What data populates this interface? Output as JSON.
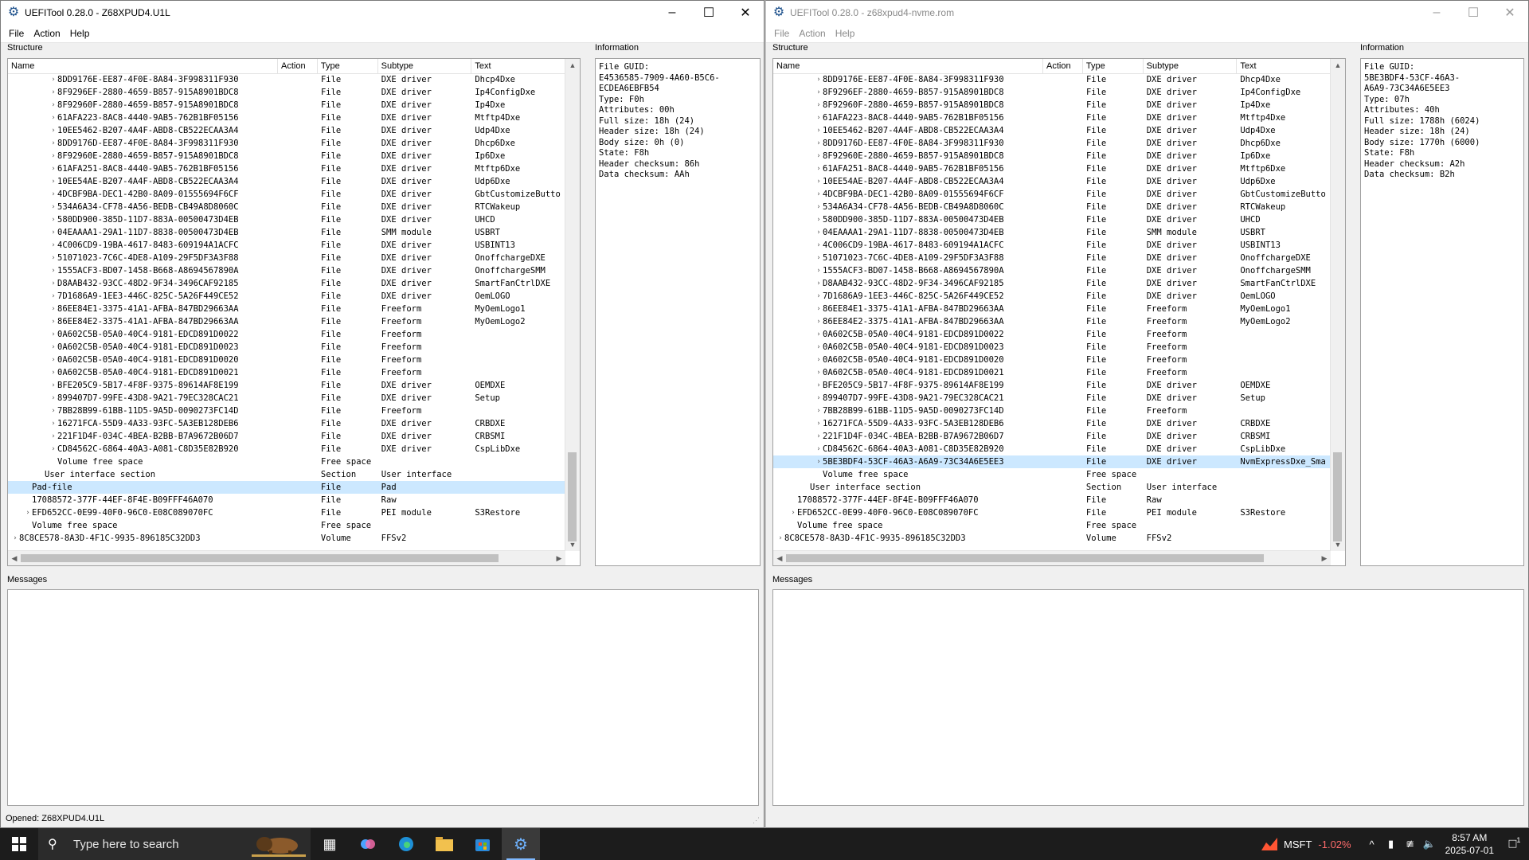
{
  "windows": [
    {
      "id": "L",
      "title": "UEFITool 0.28.0 - Z68XPUD4.U1L",
      "active": true,
      "menu": [
        "File",
        "Action",
        "Help"
      ],
      "labels": {
        "structure": "Structure",
        "information": "Information",
        "messages": "Messages"
      },
      "columns": [
        "Name",
        "Action",
        "Type",
        "Subtype",
        "Text"
      ],
      "rows": [
        {
          "indent": 3,
          "arrow": "›",
          "name": "8DD9176E-EE87-4F0E-8A84-3F998311F930",
          "action": "",
          "type": "File",
          "subtype": "DXE driver",
          "text": "Dhcp4Dxe"
        },
        {
          "indent": 3,
          "arrow": "›",
          "name": "8F9296EF-2880-4659-B857-915A8901BDC8",
          "action": "",
          "type": "File",
          "subtype": "DXE driver",
          "text": "Ip4ConfigDxe"
        },
        {
          "indent": 3,
          "arrow": "›",
          "name": "8F92960F-2880-4659-B857-915A8901BDC8",
          "action": "",
          "type": "File",
          "subtype": "DXE driver",
          "text": "Ip4Dxe"
        },
        {
          "indent": 3,
          "arrow": "›",
          "name": "61AFA223-8AC8-4440-9AB5-762B1BF05156",
          "action": "",
          "type": "File",
          "subtype": "DXE driver",
          "text": "Mtftp4Dxe"
        },
        {
          "indent": 3,
          "arrow": "›",
          "name": "10EE5462-B207-4A4F-ABD8-CB522ECAA3A4",
          "action": "",
          "type": "File",
          "subtype": "DXE driver",
          "text": "Udp4Dxe"
        },
        {
          "indent": 3,
          "arrow": "›",
          "name": "8DD9176D-EE87-4F0E-8A84-3F998311F930",
          "action": "",
          "type": "File",
          "subtype": "DXE driver",
          "text": "Dhcp6Dxe"
        },
        {
          "indent": 3,
          "arrow": "›",
          "name": "8F92960E-2880-4659-B857-915A8901BDC8",
          "action": "",
          "type": "File",
          "subtype": "DXE driver",
          "text": "Ip6Dxe"
        },
        {
          "indent": 3,
          "arrow": "›",
          "name": "61AFA251-8AC8-4440-9AB5-762B1BF05156",
          "action": "",
          "type": "File",
          "subtype": "DXE driver",
          "text": "Mtftp6Dxe"
        },
        {
          "indent": 3,
          "arrow": "›",
          "name": "10EE54AE-B207-4A4F-ABD8-CB522ECAA3A4",
          "action": "",
          "type": "File",
          "subtype": "DXE driver",
          "text": "Udp6Dxe"
        },
        {
          "indent": 3,
          "arrow": "›",
          "name": "4DCBF9BA-DEC1-42B0-8A09-01555694F6CF",
          "action": "",
          "type": "File",
          "subtype": "DXE driver",
          "text": "GbtCustomizeButto"
        },
        {
          "indent": 3,
          "arrow": "›",
          "name": "534A6A34-CF78-4A56-BEDB-CB49A8D8060C",
          "action": "",
          "type": "File",
          "subtype": "DXE driver",
          "text": "RTCWakeup"
        },
        {
          "indent": 3,
          "arrow": "›",
          "name": "580DD900-385D-11D7-883A-00500473D4EB",
          "action": "",
          "type": "File",
          "subtype": "DXE driver",
          "text": "UHCD"
        },
        {
          "indent": 3,
          "arrow": "›",
          "name": "04EAAAA1-29A1-11D7-8838-00500473D4EB",
          "action": "",
          "type": "File",
          "subtype": "SMM module",
          "text": "USBRT"
        },
        {
          "indent": 3,
          "arrow": "›",
          "name": "4C006CD9-19BA-4617-8483-609194A1ACFC",
          "action": "",
          "type": "File",
          "subtype": "DXE driver",
          "text": "USBINT13"
        },
        {
          "indent": 3,
          "arrow": "›",
          "name": "51071023-7C6C-4DE8-A109-29F5DF3A3F88",
          "action": "",
          "type": "File",
          "subtype": "DXE driver",
          "text": "OnoffchargeDXE"
        },
        {
          "indent": 3,
          "arrow": "›",
          "name": "1555ACF3-BD07-1458-B668-A8694567890A",
          "action": "",
          "type": "File",
          "subtype": "DXE driver",
          "text": "OnoffchargeSMM"
        },
        {
          "indent": 3,
          "arrow": "›",
          "name": "D8AAB432-93CC-48D2-9F34-3496CAF92185",
          "action": "",
          "type": "File",
          "subtype": "DXE driver",
          "text": "SmartFanCtrlDXE"
        },
        {
          "indent": 3,
          "arrow": "›",
          "name": "7D1686A9-1EE3-446C-825C-5A26F449CE52",
          "action": "",
          "type": "File",
          "subtype": "DXE driver",
          "text": "OemLOGO"
        },
        {
          "indent": 3,
          "arrow": "›",
          "name": "86EE84E1-3375-41A1-AFBA-847BD29663AA",
          "action": "",
          "type": "File",
          "subtype": "Freeform",
          "text": "MyOemLogo1"
        },
        {
          "indent": 3,
          "arrow": "›",
          "name": "86EE84E2-3375-41A1-AFBA-847BD29663AA",
          "action": "",
          "type": "File",
          "subtype": "Freeform",
          "text": "MyOemLogo2"
        },
        {
          "indent": 3,
          "arrow": "›",
          "name": "0A602C5B-05A0-40C4-9181-EDCD891D0022",
          "action": "",
          "type": "File",
          "subtype": "Freeform",
          "text": ""
        },
        {
          "indent": 3,
          "arrow": "›",
          "name": "0A602C5B-05A0-40C4-9181-EDCD891D0023",
          "action": "",
          "type": "File",
          "subtype": "Freeform",
          "text": ""
        },
        {
          "indent": 3,
          "arrow": "›",
          "name": "0A602C5B-05A0-40C4-9181-EDCD891D0020",
          "action": "",
          "type": "File",
          "subtype": "Freeform",
          "text": ""
        },
        {
          "indent": 3,
          "arrow": "›",
          "name": "0A602C5B-05A0-40C4-9181-EDCD891D0021",
          "action": "",
          "type": "File",
          "subtype": "Freeform",
          "text": ""
        },
        {
          "indent": 3,
          "arrow": "›",
          "name": "BFE205C9-5B17-4F8F-9375-89614AF8E199",
          "action": "",
          "type": "File",
          "subtype": "DXE driver",
          "text": "OEMDXE"
        },
        {
          "indent": 3,
          "arrow": "›",
          "name": "899407D7-99FE-43D8-9A21-79EC328CAC21",
          "action": "",
          "type": "File",
          "subtype": "DXE driver",
          "text": "Setup"
        },
        {
          "indent": 3,
          "arrow": "›",
          "name": "7BB28B99-61BB-11D5-9A5D-0090273FC14D",
          "action": "",
          "type": "File",
          "subtype": "Freeform",
          "text": ""
        },
        {
          "indent": 3,
          "arrow": "›",
          "name": "16271FCA-55D9-4A33-93FC-5A3EB128DEB6",
          "action": "",
          "type": "File",
          "subtype": "DXE driver",
          "text": "CRBDXE"
        },
        {
          "indent": 3,
          "arrow": "›",
          "name": "221F1D4F-034C-4BEA-B2BB-B7A9672B06D7",
          "action": "",
          "type": "File",
          "subtype": "DXE driver",
          "text": "CRBSMI"
        },
        {
          "indent": 3,
          "arrow": "›",
          "name": "CD84562C-6864-40A3-A081-C8D35E82B920",
          "action": "",
          "type": "File",
          "subtype": "DXE driver",
          "text": "CspLibDxe"
        },
        {
          "indent": 3,
          "arrow": "",
          "name": "Volume free space",
          "action": "",
          "type": "Free space",
          "subtype": "",
          "text": ""
        },
        {
          "indent": 2,
          "arrow": "",
          "name": "User interface section",
          "action": "",
          "type": "Section",
          "subtype": "User interface",
          "text": ""
        },
        {
          "indent": 1,
          "arrow": "",
          "name": "Pad-file",
          "action": "",
          "type": "File",
          "subtype": "Pad",
          "text": "",
          "selected": true
        },
        {
          "indent": 1,
          "arrow": "",
          "name": "17088572-377F-44EF-8F4E-B09FFF46A070",
          "action": "",
          "type": "File",
          "subtype": "Raw",
          "text": ""
        },
        {
          "indent": 1,
          "arrow": "›",
          "name": "EFD652CC-0E99-40F0-96C0-E08C089070FC",
          "action": "",
          "type": "File",
          "subtype": "PEI module",
          "text": "S3Restore"
        },
        {
          "indent": 1,
          "arrow": "",
          "name": "Volume free space",
          "action": "",
          "type": "Free space",
          "subtype": "",
          "text": ""
        },
        {
          "indent": 0,
          "arrow": "›",
          "name": "8C8CE578-8A3D-4F1C-9935-896185C32DD3",
          "action": "",
          "type": "Volume",
          "subtype": "FFSv2",
          "text": ""
        }
      ],
      "info": "File GUID:\nE4536585-7909-4A60-B5C6-\nECDEA6EBFB54\nType: F0h\nAttributes: 00h\nFull size: 18h (24)\nHeader size: 18h (24)\nBody size: 0h (0)\nState: F8h\nHeader checksum: 86h\nData checksum: AAh",
      "status": "Opened: Z68XPUD4.U1L"
    },
    {
      "id": "R",
      "title": "UEFITool 0.28.0 - z68xpud4-nvme.rom",
      "active": false,
      "menu": [
        "File",
        "Action",
        "Help"
      ],
      "labels": {
        "structure": "Structure",
        "information": "Information",
        "messages": "Messages"
      },
      "columns": [
        "Name",
        "Action",
        "Type",
        "Subtype",
        "Text"
      ],
      "rows": [
        {
          "indent": 3,
          "arrow": "›",
          "name": "8DD9176E-EE87-4F0E-8A84-3F998311F930",
          "action": "",
          "type": "File",
          "subtype": "DXE driver",
          "text": "Dhcp4Dxe"
        },
        {
          "indent": 3,
          "arrow": "›",
          "name": "8F9296EF-2880-4659-B857-915A8901BDC8",
          "action": "",
          "type": "File",
          "subtype": "DXE driver",
          "text": "Ip4ConfigDxe"
        },
        {
          "indent": 3,
          "arrow": "›",
          "name": "8F92960F-2880-4659-B857-915A8901BDC8",
          "action": "",
          "type": "File",
          "subtype": "DXE driver",
          "text": "Ip4Dxe"
        },
        {
          "indent": 3,
          "arrow": "›",
          "name": "61AFA223-8AC8-4440-9AB5-762B1BF05156",
          "action": "",
          "type": "File",
          "subtype": "DXE driver",
          "text": "Mtftp4Dxe"
        },
        {
          "indent": 3,
          "arrow": "›",
          "name": "10EE5462-B207-4A4F-ABD8-CB522ECAA3A4",
          "action": "",
          "type": "File",
          "subtype": "DXE driver",
          "text": "Udp4Dxe"
        },
        {
          "indent": 3,
          "arrow": "›",
          "name": "8DD9176D-EE87-4F0E-8A84-3F998311F930",
          "action": "",
          "type": "File",
          "subtype": "DXE driver",
          "text": "Dhcp6Dxe"
        },
        {
          "indent": 3,
          "arrow": "›",
          "name": "8F92960E-2880-4659-B857-915A8901BDC8",
          "action": "",
          "type": "File",
          "subtype": "DXE driver",
          "text": "Ip6Dxe"
        },
        {
          "indent": 3,
          "arrow": "›",
          "name": "61AFA251-8AC8-4440-9AB5-762B1BF05156",
          "action": "",
          "type": "File",
          "subtype": "DXE driver",
          "text": "Mtftp6Dxe"
        },
        {
          "indent": 3,
          "arrow": "›",
          "name": "10EE54AE-B207-4A4F-ABD8-CB522ECAA3A4",
          "action": "",
          "type": "File",
          "subtype": "DXE driver",
          "text": "Udp6Dxe"
        },
        {
          "indent": 3,
          "arrow": "›",
          "name": "4DCBF9BA-DEC1-42B0-8A09-01555694F6CF",
          "action": "",
          "type": "File",
          "subtype": "DXE driver",
          "text": "GbtCustomizeButto"
        },
        {
          "indent": 3,
          "arrow": "›",
          "name": "534A6A34-CF78-4A56-BEDB-CB49A8D8060C",
          "action": "",
          "type": "File",
          "subtype": "DXE driver",
          "text": "RTCWakeup"
        },
        {
          "indent": 3,
          "arrow": "›",
          "name": "580DD900-385D-11D7-883A-00500473D4EB",
          "action": "",
          "type": "File",
          "subtype": "DXE driver",
          "text": "UHCD"
        },
        {
          "indent": 3,
          "arrow": "›",
          "name": "04EAAAA1-29A1-11D7-8838-00500473D4EB",
          "action": "",
          "type": "File",
          "subtype": "SMM module",
          "text": "USBRT"
        },
        {
          "indent": 3,
          "arrow": "›",
          "name": "4C006CD9-19BA-4617-8483-609194A1ACFC",
          "action": "",
          "type": "File",
          "subtype": "DXE driver",
          "text": "USBINT13"
        },
        {
          "indent": 3,
          "arrow": "›",
          "name": "51071023-7C6C-4DE8-A109-29F5DF3A3F88",
          "action": "",
          "type": "File",
          "subtype": "DXE driver",
          "text": "OnoffchargeDXE"
        },
        {
          "indent": 3,
          "arrow": "›",
          "name": "1555ACF3-BD07-1458-B668-A8694567890A",
          "action": "",
          "type": "File",
          "subtype": "DXE driver",
          "text": "OnoffchargeSMM"
        },
        {
          "indent": 3,
          "arrow": "›",
          "name": "D8AAB432-93CC-48D2-9F34-3496CAF92185",
          "action": "",
          "type": "File",
          "subtype": "DXE driver",
          "text": "SmartFanCtrlDXE"
        },
        {
          "indent": 3,
          "arrow": "›",
          "name": "7D1686A9-1EE3-446C-825C-5A26F449CE52",
          "action": "",
          "type": "File",
          "subtype": "DXE driver",
          "text": "OemLOGO"
        },
        {
          "indent": 3,
          "arrow": "›",
          "name": "86EE84E1-3375-41A1-AFBA-847BD29663AA",
          "action": "",
          "type": "File",
          "subtype": "Freeform",
          "text": "MyOemLogo1"
        },
        {
          "indent": 3,
          "arrow": "›",
          "name": "86EE84E2-3375-41A1-AFBA-847BD29663AA",
          "action": "",
          "type": "File",
          "subtype": "Freeform",
          "text": "MyOemLogo2"
        },
        {
          "indent": 3,
          "arrow": "›",
          "name": "0A602C5B-05A0-40C4-9181-EDCD891D0022",
          "action": "",
          "type": "File",
          "subtype": "Freeform",
          "text": ""
        },
        {
          "indent": 3,
          "arrow": "›",
          "name": "0A602C5B-05A0-40C4-9181-EDCD891D0023",
          "action": "",
          "type": "File",
          "subtype": "Freeform",
          "text": ""
        },
        {
          "indent": 3,
          "arrow": "›",
          "name": "0A602C5B-05A0-40C4-9181-EDCD891D0020",
          "action": "",
          "type": "File",
          "subtype": "Freeform",
          "text": ""
        },
        {
          "indent": 3,
          "arrow": "›",
          "name": "0A602C5B-05A0-40C4-9181-EDCD891D0021",
          "action": "",
          "type": "File",
          "subtype": "Freeform",
          "text": ""
        },
        {
          "indent": 3,
          "arrow": "›",
          "name": "BFE205C9-5B17-4F8F-9375-89614AF8E199",
          "action": "",
          "type": "File",
          "subtype": "DXE driver",
          "text": "OEMDXE"
        },
        {
          "indent": 3,
          "arrow": "›",
          "name": "899407D7-99FE-43D8-9A21-79EC328CAC21",
          "action": "",
          "type": "File",
          "subtype": "DXE driver",
          "text": "Setup"
        },
        {
          "indent": 3,
          "arrow": "›",
          "name": "7BB28B99-61BB-11D5-9A5D-0090273FC14D",
          "action": "",
          "type": "File",
          "subtype": "Freeform",
          "text": ""
        },
        {
          "indent": 3,
          "arrow": "›",
          "name": "16271FCA-55D9-4A33-93FC-5A3EB128DEB6",
          "action": "",
          "type": "File",
          "subtype": "DXE driver",
          "text": "CRBDXE"
        },
        {
          "indent": 3,
          "arrow": "›",
          "name": "221F1D4F-034C-4BEA-B2BB-B7A9672B06D7",
          "action": "",
          "type": "File",
          "subtype": "DXE driver",
          "text": "CRBSMI"
        },
        {
          "indent": 3,
          "arrow": "›",
          "name": "CD84562C-6864-40A3-A081-C8D35E82B920",
          "action": "",
          "type": "File",
          "subtype": "DXE driver",
          "text": "CspLibDxe"
        },
        {
          "indent": 3,
          "arrow": "›",
          "name": "5BE3BDF4-53CF-46A3-A6A9-73C34A6E5EE3",
          "action": "",
          "type": "File",
          "subtype": "DXE driver",
          "text": "NvmExpressDxe_Sma",
          "selected": true
        },
        {
          "indent": 3,
          "arrow": "",
          "name": "Volume free space",
          "action": "",
          "type": "Free space",
          "subtype": "",
          "text": ""
        },
        {
          "indent": 2,
          "arrow": "",
          "name": "User interface section",
          "action": "",
          "type": "Section",
          "subtype": "User interface",
          "text": ""
        },
        {
          "indent": 1,
          "arrow": "",
          "name": "17088572-377F-44EF-8F4E-B09FFF46A070",
          "action": "",
          "type": "File",
          "subtype": "Raw",
          "text": ""
        },
        {
          "indent": 1,
          "arrow": "›",
          "name": "EFD652CC-0E99-40F0-96C0-E08C089070FC",
          "action": "",
          "type": "File",
          "subtype": "PEI module",
          "text": "S3Restore"
        },
        {
          "indent": 1,
          "arrow": "",
          "name": "Volume free space",
          "action": "",
          "type": "Free space",
          "subtype": "",
          "text": ""
        },
        {
          "indent": 0,
          "arrow": "›",
          "name": "8C8CE578-8A3D-4F1C-9935-896185C32DD3",
          "action": "",
          "type": "Volume",
          "subtype": "FFSv2",
          "text": ""
        }
      ],
      "info": "File GUID:\n5BE3BDF4-53CF-46A3-\nA6A9-73C34A6E5EE3\nType: 07h\nAttributes: 40h\nFull size: 1788h (6024)\nHeader size: 18h (24)\nBody size: 1770h (6000)\nState: F8h\nHeader checksum: A2h\nData checksum: B2h",
      "status": ""
    }
  ],
  "taskbar": {
    "search_placeholder": "Type here to search",
    "stock": {
      "ticker": "MSFT",
      "change": "-1.02%"
    },
    "time": "8:57 AM",
    "date": "2025-07-01",
    "notification_count": "1"
  },
  "colors": {
    "selection": "#cce8ff",
    "taskbar": "#1c1c1c",
    "stock_down": "#ff6b6b"
  }
}
